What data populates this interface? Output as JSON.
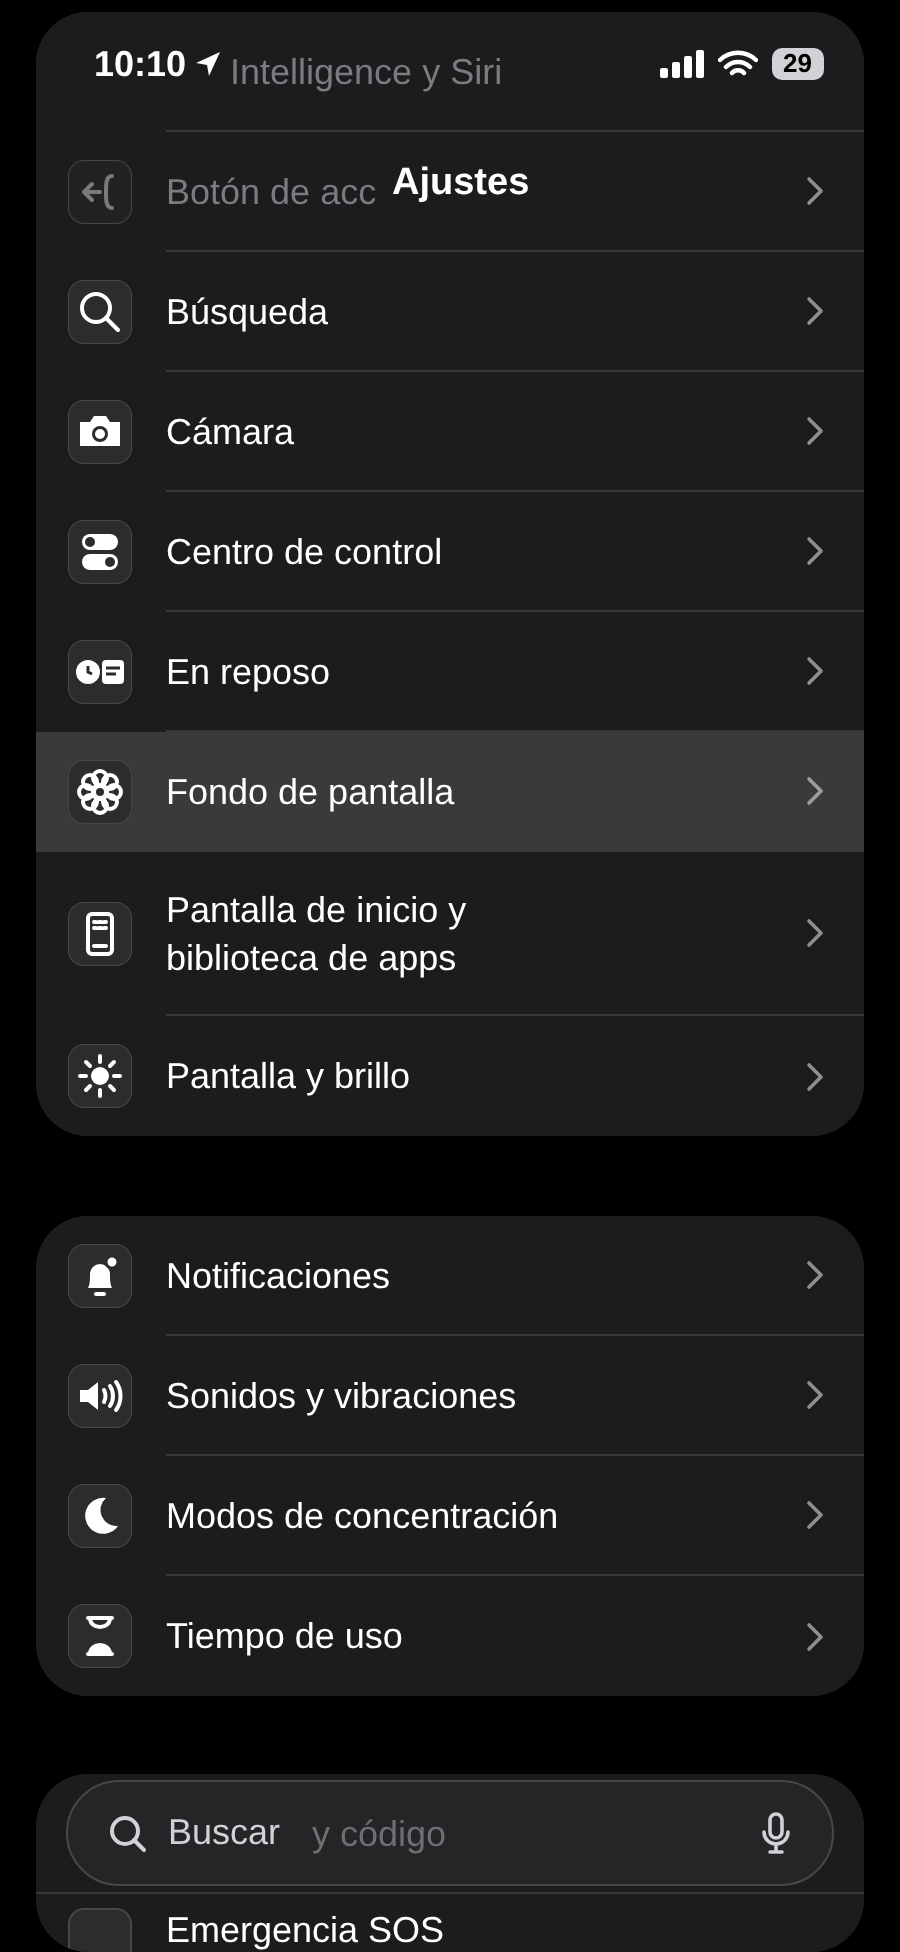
{
  "status_bar": {
    "time": "10:10",
    "battery": "29"
  },
  "title": "Ajustes",
  "groups": [
    {
      "items": [
        {
          "kind": "faded",
          "label": "Intelligence y Siri",
          "selected": false
        },
        {
          "kind": "faded",
          "label": "Botón de acc",
          "selected": false
        },
        {
          "kind": "row",
          "label": "Búsqueda",
          "selected": false
        },
        {
          "kind": "row",
          "label": "Cámara",
          "selected": false
        },
        {
          "kind": "row",
          "label": "Centro de control",
          "selected": false
        },
        {
          "kind": "row",
          "label": "En reposo",
          "selected": false
        },
        {
          "kind": "row",
          "label": "Fondo de pantalla",
          "selected": true
        },
        {
          "kind": "row",
          "label": "Pantalla de inicio y biblioteca de apps",
          "selected": false
        },
        {
          "kind": "row",
          "label": "Pantalla y brillo",
          "selected": false
        }
      ]
    },
    {
      "items": [
        {
          "kind": "row",
          "label": "Notificaciones",
          "selected": false
        },
        {
          "kind": "row",
          "label": "Sonidos y vibraciones",
          "selected": false
        },
        {
          "kind": "row",
          "label": "Modos de concentración",
          "selected": false
        },
        {
          "kind": "row",
          "label": "Tiempo de uso",
          "selected": false
        }
      ]
    },
    {
      "items": [
        {
          "kind": "covered",
          "label": "y código"
        },
        {
          "kind": "row",
          "label": "Emergencia SOS",
          "selected": false
        }
      ]
    }
  ],
  "search": {
    "placeholder": "Buscar"
  }
}
